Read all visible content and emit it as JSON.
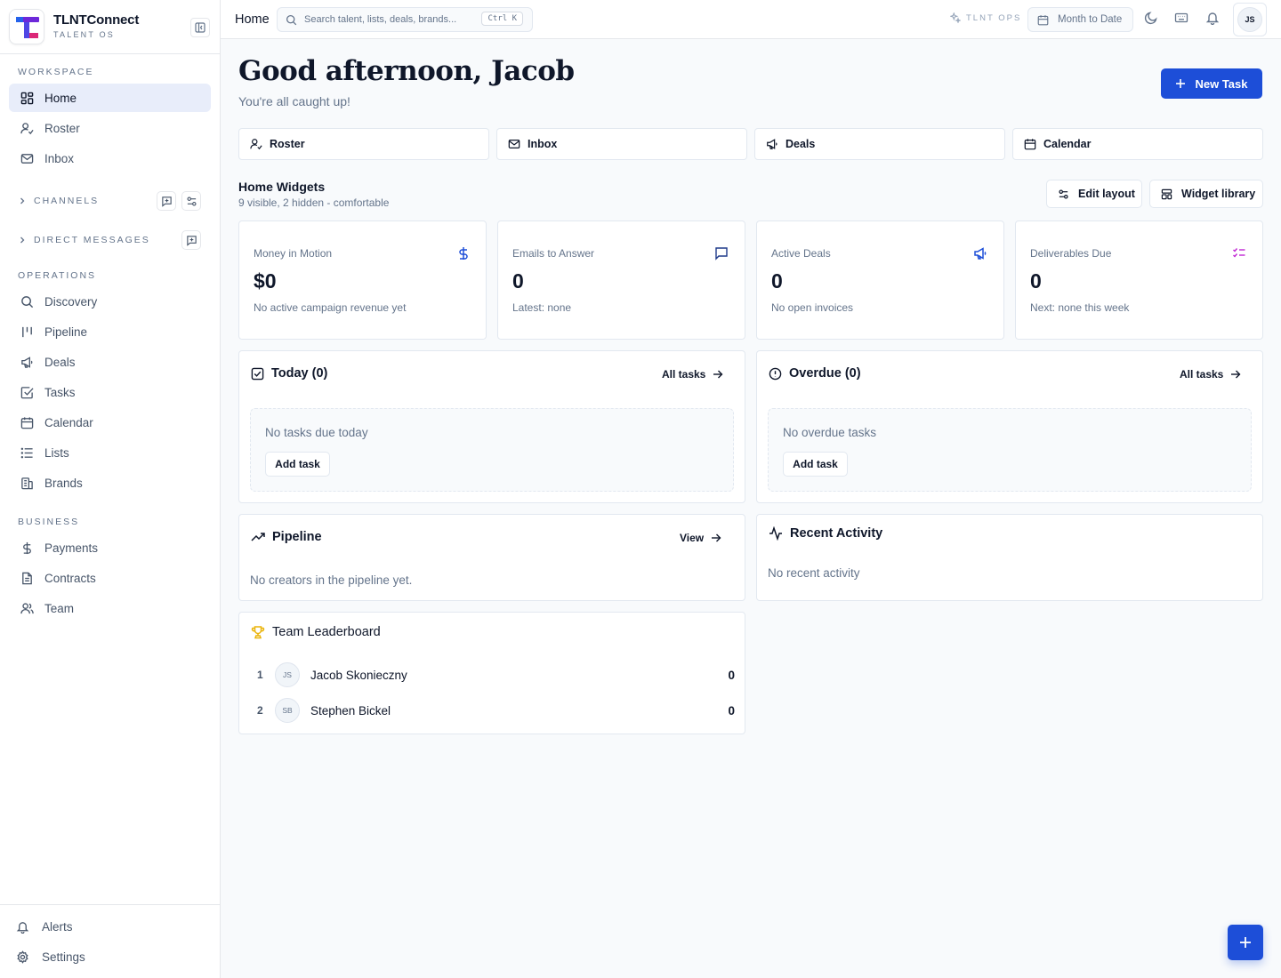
{
  "app": {
    "name": "TLNTConnect",
    "tagline": "TALENT OS"
  },
  "sidebar": {
    "workspace_label": "WORKSPACE",
    "workspace_items": [
      {
        "label": "Home",
        "icon": "grid-icon",
        "active": true
      },
      {
        "label": "Roster",
        "icon": "user-check-icon"
      },
      {
        "label": "Inbox",
        "icon": "mail-icon"
      }
    ],
    "channels_label": "CHANNELS",
    "direct_messages_label": "DIRECT MESSAGES",
    "operations_label": "OPERATIONS",
    "operations_items": [
      {
        "label": "Discovery",
        "icon": "search-icon"
      },
      {
        "label": "Pipeline",
        "icon": "pipeline-icon"
      },
      {
        "label": "Deals",
        "icon": "megaphone-icon"
      },
      {
        "label": "Tasks",
        "icon": "checkbox-icon"
      },
      {
        "label": "Calendar",
        "icon": "calendar-icon"
      },
      {
        "label": "Lists",
        "icon": "list-icon"
      },
      {
        "label": "Brands",
        "icon": "building-icon"
      }
    ],
    "business_label": "BUSINESS",
    "business_items": [
      {
        "label": "Payments",
        "icon": "dollar-icon"
      },
      {
        "label": "Contracts",
        "icon": "document-icon"
      },
      {
        "label": "Team",
        "icon": "users-icon"
      }
    ],
    "bottom_items": [
      {
        "label": "Alerts",
        "icon": "bell-icon"
      },
      {
        "label": "Settings",
        "icon": "gear-icon"
      }
    ]
  },
  "topbar": {
    "breadcrumb": "Home",
    "search_placeholder": "Search talent, lists, deals, brands...",
    "search_shortcut": "Ctrl K",
    "ops_label": "TLNT OPS",
    "date_range": "Month to Date",
    "user_initials": "JS"
  },
  "main": {
    "greeting": "Good afternoon, Jacob",
    "subgreeting": "You're all caught up!",
    "new_task_label": "New Task",
    "quick_links": [
      {
        "label": "Roster",
        "icon": "user-check-icon"
      },
      {
        "label": "Inbox",
        "icon": "mail-icon"
      },
      {
        "label": "Deals",
        "icon": "megaphone-icon"
      },
      {
        "label": "Calendar",
        "icon": "calendar-icon"
      }
    ],
    "widgets_title": "Home Widgets",
    "widgets_subtitle": "9 visible, 2 hidden - comfortable",
    "edit_layout_label": "Edit layout",
    "widget_library_label": "Widget library",
    "stats": [
      {
        "label": "Money in Motion",
        "value": "$0",
        "note": "No active campaign revenue yet",
        "icon": "dollar-icon",
        "color": "#1d4ed8"
      },
      {
        "label": "Emails to Answer",
        "value": "0",
        "note": "Latest: none",
        "icon": "message-icon",
        "color": "#1e3a8a"
      },
      {
        "label": "Active Deals",
        "value": "0",
        "note": "No open invoices",
        "icon": "megaphone-icon",
        "color": "#1d4ed8"
      },
      {
        "label": "Deliverables Due",
        "value": "0",
        "note": "Next: none this week",
        "icon": "checklist-icon",
        "color": "#c026d3"
      }
    ],
    "today": {
      "title": "Today (0)",
      "link": "All tasks",
      "empty": "No tasks due today",
      "button": "Add task"
    },
    "overdue": {
      "title": "Overdue (0)",
      "link": "All tasks",
      "empty": "No overdue tasks",
      "button": "Add task"
    },
    "pipeline": {
      "title": "Pipeline",
      "link": "View",
      "empty": "No creators in the pipeline yet."
    },
    "activity": {
      "title": "Recent Activity",
      "empty": "No recent activity"
    },
    "leaderboard": {
      "title": "Team Leaderboard",
      "rows": [
        {
          "rank": "1",
          "initials": "JS",
          "name": "Jacob Skonieczny",
          "score": "0"
        },
        {
          "rank": "2",
          "initials": "SB",
          "name": "Stephen Bickel",
          "score": "0"
        }
      ]
    }
  },
  "colors": {
    "accent": "#1d4ed8",
    "active_nav": "#e8edfa",
    "trophy": "#eab308"
  }
}
